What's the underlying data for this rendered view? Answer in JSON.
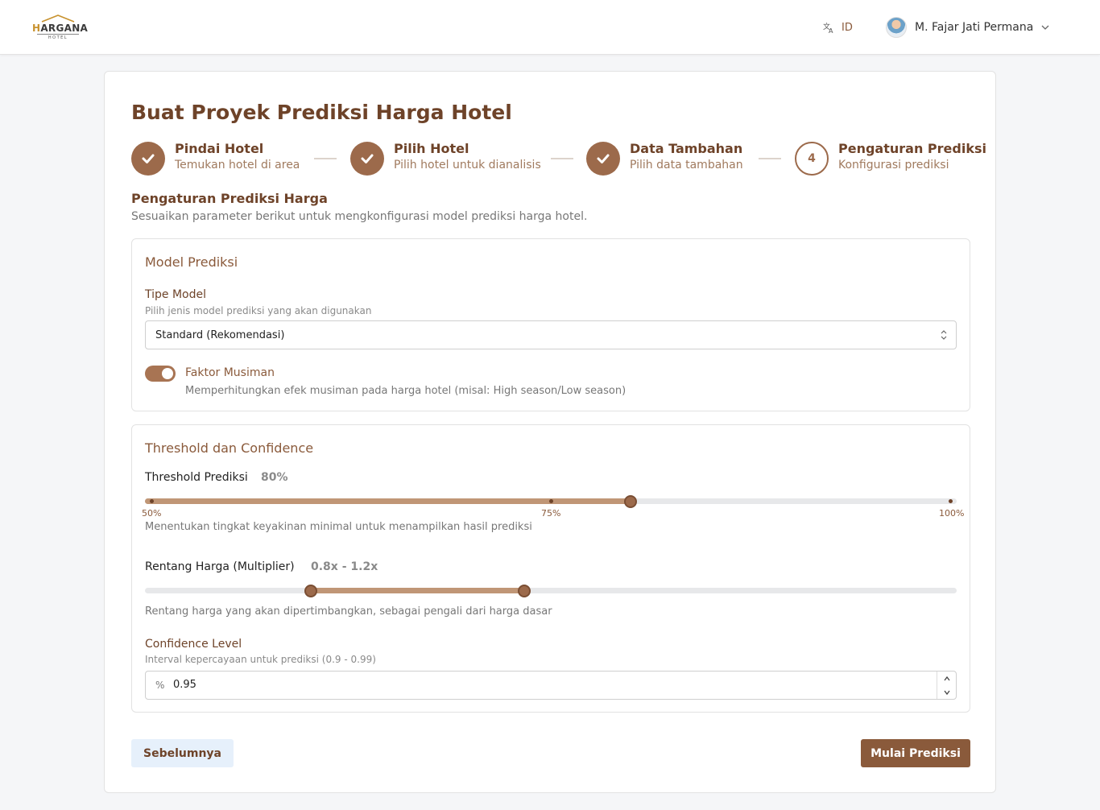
{
  "header": {
    "logo_text": "HARGANA",
    "logo_sub": "HOTEL",
    "language": "ID",
    "user_name": "M. Fajar Jati Permana"
  },
  "page": {
    "title": "Buat Proyek Prediksi Harga Hotel"
  },
  "steps": [
    {
      "title": "Pindai Hotel",
      "subtitle": "Temukan hotel di area",
      "status": "done"
    },
    {
      "title": "Pilih Hotel",
      "subtitle": "Pilih hotel untuk dianalisis",
      "status": "done"
    },
    {
      "title": "Data Tambahan",
      "subtitle": "Pilih data tambahan",
      "status": "done"
    },
    {
      "title": "Pengaturan Prediksi",
      "subtitle": "Konfigurasi prediksi",
      "status": "active",
      "number": "4"
    }
  ],
  "section": {
    "title": "Pengaturan Prediksi Harga",
    "subtitle": "Sesuaikan parameter berikut untuk mengkonfigurasi model prediksi harga hotel."
  },
  "model_panel": {
    "title": "Model Prediksi",
    "type_label": "Tipe Model",
    "type_hint": "Pilih jenis model prediksi yang akan digunakan",
    "type_value": "Standard (Rekomendasi)",
    "seasonal_label": "Faktor Musiman",
    "seasonal_hint": "Memperhitungkan efek musiman pada harga hotel (misal: High season/Low season)",
    "seasonal_enabled": true
  },
  "threshold_panel": {
    "title": "Threshold dan Confidence",
    "threshold": {
      "label": "Threshold Prediksi",
      "value_text": "80%",
      "value": 80,
      "min": 50,
      "max": 100,
      "ticks": [
        "50%",
        "75%",
        "100%"
      ],
      "hint": "Menentukan tingkat keyakinan minimal untuk menampilkan hasil prediksi"
    },
    "range": {
      "label": "Rentang Harga (Multiplier)",
      "value_text": "0.8x - 1.2x",
      "low": 0.8,
      "high": 1.2,
      "min": 0.5,
      "max": 2.0,
      "hint": "Rentang harga yang akan dipertimbangkan, sebagai pengali dari harga dasar"
    },
    "confidence": {
      "label": "Confidence Level",
      "hint": "Interval kepercayaan untuk prediksi (0.9 - 0.99)",
      "prefix": "%",
      "value": "0.95"
    }
  },
  "actions": {
    "prev_label": "Sebelumnya",
    "start_label": "Mulai Prediksi"
  },
  "colors": {
    "brand": "#8a5a3b",
    "brand_dark": "#6e4329",
    "accent_fill": "#c09676"
  }
}
